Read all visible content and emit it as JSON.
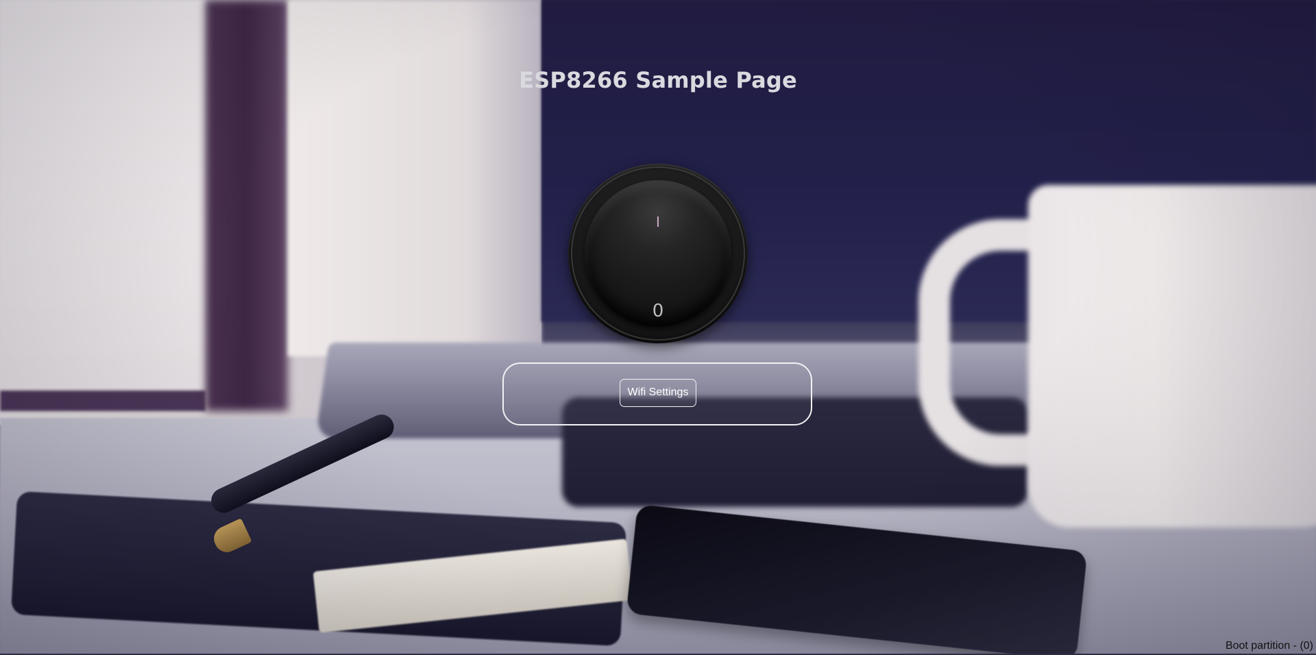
{
  "page": {
    "title": "ESP8266 Sample Page"
  },
  "switch": {
    "on_mark": "I",
    "off_mark": "0"
  },
  "wifi": {
    "button_label": "Wifi Settings"
  },
  "footer": {
    "boot_partition": "Boot partition - (0)"
  },
  "colors": {
    "title": "#d9d9df",
    "panel_border": "#f2f2f4",
    "background_primary": "#2a2748"
  }
}
